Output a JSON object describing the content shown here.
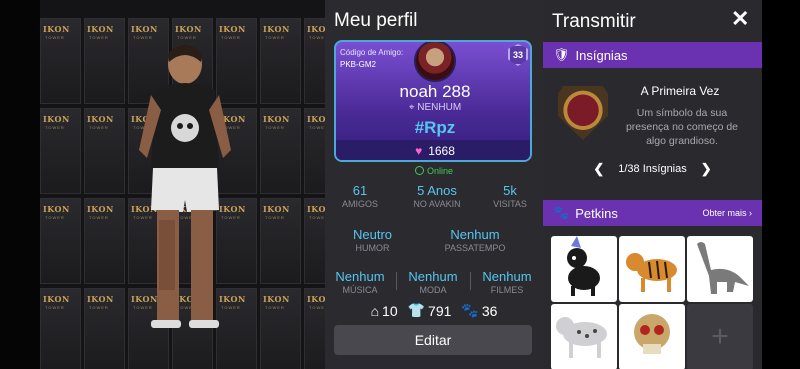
{
  "scene": {
    "poster_brand": "IKON",
    "poster_sub": "TOWER"
  },
  "profile": {
    "title": "Meu perfil",
    "friend_code_label": "Código de Amigo:",
    "friend_code": "PKB-GM2",
    "level": "33",
    "name": "noah 288",
    "location": "NENHUM",
    "tag": "#Rpz",
    "likes": "1668",
    "status": "Online",
    "stats": [
      {
        "value": "61",
        "label": "AMIGOS"
      },
      {
        "value": "5 Anos",
        "label": "NO AVAKIN"
      },
      {
        "value": "5k",
        "label": "VISITAS"
      }
    ],
    "mood": [
      {
        "value": "Neutro",
        "label": "HUMOR"
      },
      {
        "value": "Nenhum",
        "label": "PASSATEMPO"
      }
    ],
    "favorites": [
      {
        "value": "Nenhum",
        "label": "MÚSICA"
      },
      {
        "value": "Nenhum",
        "label": "MODA"
      },
      {
        "value": "Nenhum",
        "label": "FILMES"
      }
    ],
    "counts": {
      "homes": "10",
      "outfits": "791",
      "pets": "36"
    },
    "edit_label": "Editar"
  },
  "broadcast": {
    "title": "Transmitir",
    "close_glyph": "✕",
    "badges_header": "Insígnias",
    "badge_name": "A Primeira Vez",
    "badge_desc": "Um símbolo da sua presença no começo de algo grandioso.",
    "badge_pager": "1/38 Insígnias",
    "pets_header": "Petkins",
    "pets_more": "Obter mais ›",
    "pets": [
      "black-cat-icon",
      "tiger-icon",
      "dinosaur-icon",
      "snow-leopard-icon",
      "skull-pet-icon"
    ]
  },
  "colors": {
    "accent": "#6a32b0",
    "link": "#55c6f0",
    "online": "#41c85a",
    "card_border": "#4aa9d9"
  }
}
